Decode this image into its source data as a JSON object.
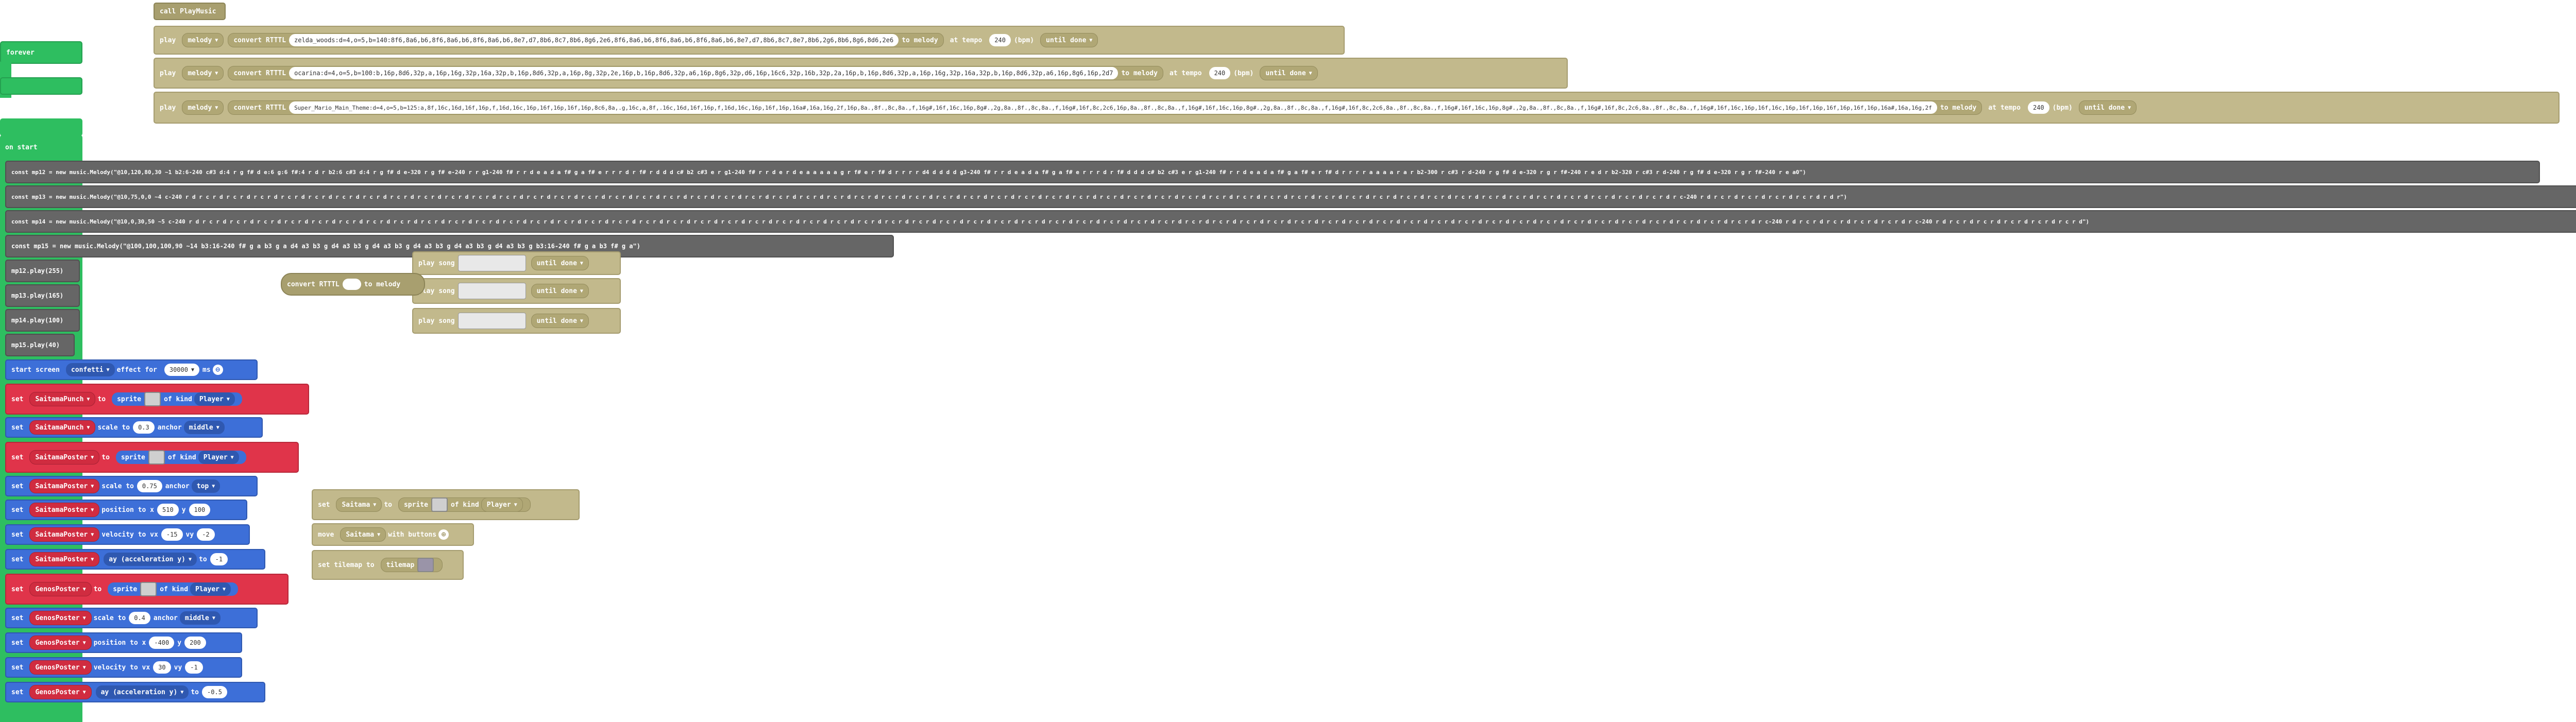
{
  "header": {
    "fn_label": "call PlayMusic"
  },
  "play_rows": [
    {
      "play": "play",
      "melody": "melody",
      "convert": "convert RTTTL",
      "rtttl": "zelda_woods:d=4,o=5,b=140:8f6,8a6,b6,8f6,8a6,b6,8f6,8a6,b6,8e7,d7,8b6,8c7,8b6,8g6,2e6,8f6,8a6,b6,8f6,8a6,b6,8f6,8a6,b6,8e7,d7,8b6,8c7,8e7,8b6,2g6,8b6,8g6,8d6,2e6",
      "to_melody": "to melody",
      "at_tempo": "at tempo",
      "tempo": "240",
      "bpm": "(bpm)",
      "until": "until done"
    },
    {
      "play": "play",
      "melody": "melody",
      "convert": "convert RTTTL",
      "rtttl": "ocarina:d=4,o=5,b=100:b,16p,8d6,32p,a,16p,16g,32p,16a,32p,b,16p,8d6,32p,a,16p,8g,32p,2e,16p,b,16p,8d6,32p,a6,16p,8g6,32p,d6,16p,16c6,32p,16b,32p,2a,16p,b,16p,8d6,32p,a,16p,16g,32p,16a,32p,b,16p,8d6,32p,a6,16p,8g6,16p,2d7",
      "to_melody": "to melody",
      "at_tempo": "at tempo",
      "tempo": "240",
      "bpm": "(bpm)",
      "until": "until done"
    },
    {
      "play": "play",
      "melody": "melody",
      "convert": "convert RTTTL",
      "rtttl": "Super_Mario_Main_Theme:d=4,o=5,b=125:a,8f,16c,16d,16f,16p,f,16d,16c,16p,16f,16p,16f,16p,8c6,8a,.g,16c,a,8f,.16c,16d,16f,16p,f,16d,16c,16p,16f,16p,16a#,16a,16g,2f,16p,8a.,8f.,8c,8a.,f,16g#,16f,16c,16p,8g#.,2g,8a.,8f.,8c,8a.,f,16g#,16f,8c,2c6,16p,8a.,8f.,8c,8a.,f,16g#,16f,16c,16p,8g#.,2g,8a.,8f.,8c,8a.,f,16g#,16f,8c,2c6,8a.,8f.,8c,8a.,f,16g#,16f,16c,16p,8g#.,2g,8a.,8f.,8c,8a.,f,16g#,16f,8c,2c6,8a.,8f.,8c,8a.,f,16g#,16f,16c,16p,16f,16c,16p,16f,16p,16f,16p,16f,16p,16a#,16a,16g,2f",
      "to_melody": "to melody",
      "at_tempo": "at tempo",
      "tempo": "240",
      "bpm": "(bpm)",
      "until": "until done"
    }
  ],
  "forever": {
    "label": "forever"
  },
  "on_start": {
    "label": "on start"
  },
  "const_rows": [
    {
      "text": "const mp12 = new music.Melody(\"@10,120,80,30 ~1 b2:6-240 c#3 d:4 r g f# d e:6 g:6 f#:4 r d r b2:6 c#3 d:4 r g f# d e-320 r g f# e-240 r r g1-240 f# r r d e a d a f# g a f# e r r r d r f# r d d d c# b2 c#3 e r g1-240 f# r r d e r d e a a a a a g r f# e r f# d r r r r d4 d d d d g3-240 f# r r d e a d a f# g a f# e r r r d r f# d d d c# b2 c#3 e r g1-240 f# r r d e a d a f# g a f# e r f# d r r r r a a a a r a r b2-300 r c#3 r d-240 r g f# d e-320 r g r f#-240 r e d r b2-320 r c#3 r d-240 r g f# d e-320 r g r f#-240 r e a0\")"
    },
    {
      "text": "const mp13 = new music.Melody(\"@10,75,0,0 ~4 c-240 r d r c r d r c r d r c r d r c r d r c r d r c r d r c r d r c r d r c r d r c r d r c r d r c r d r c r d r c r d r c r d r c r d r c r d r c r d r c r d r c r d r c r d r c r d r c r d r c r d r c r d r c r d r c r d r c r d r c r d r c r d r c r d r c r d r c r d r c r d r c r d r c r d r c r d r c r d r c r d r c r d r c r d r c r d r c r d r c r d r c r d r c r d r c r d r c r d r c r d r c r d r c r d r c r d r c r d r c r d r c-240 r d r c r d r c r d r c r d r c r d r d r\")"
    },
    {
      "text": "const mp14 = new music.Melody(\"@10,0,30,50 ~5 c-240 r d r c r d r c r d r c r d r c r d r c r d r c r d r c r d r c r d r c r d r c r d r c r d r c r d r c r d r c r d r c r d r c r d r c r d r c r d r c r d r c r d r c r d r c r d r c r d r c r d r c r d r c r d r c r d r c r d r c r d r c r d r c r d r c r d r c r d r c r d r c r d r c r d r c r d r c r d r c r d r c r d r c r d r c r d r c r d r c r d r c r d r c r d r c r d r c r d r c r d r c r d r c r d r c r d r c r d r c r d r c r d r c r d r c r d r c-240 r d r c r d r c r d r c r d r c r d r c-240 r d r c r d r c r d r c r d r c r d r c r d\")"
    },
    {
      "text": "const mp15 = new music.Melody(\"@100,100,100,90 ~14 b3:16-240 f# g a b3 g a d4 a3 b3 g d4 a3 b3 g d4 a3 b3 g d4 a3 b3 g d4 a3 b3 g d4 a3 b3 g b3:16-240 f# g a b3 f# g a\")"
    }
  ],
  "mp_plays": [
    "mp12.play(255)",
    "mp13.play(165)",
    "mp14.play(100)",
    "mp15.play(40)"
  ],
  "song_rows": [
    {
      "play": "play",
      "song": "song",
      "until": "until done"
    },
    {
      "play": "play",
      "song": "song",
      "until": "until done"
    },
    {
      "play": "play",
      "song": "song",
      "until": "until done"
    }
  ],
  "convert_small": {
    "label": "convert RTTTL",
    "to_melody": "to melody"
  },
  "effect": {
    "start": "start screen",
    "name": "confetti",
    "effect_for": "effect for",
    "ms_value": "30000",
    "ms": "ms"
  },
  "sprite_blocks": [
    {
      "set": "set",
      "var": "SaitamaPunch",
      "to": "to",
      "sprite": "sprite",
      "of_kind": "of kind",
      "kind": "Player"
    },
    {
      "set": "set",
      "var": "SaitamaPoster",
      "to": "to",
      "sprite": "sprite",
      "of_kind": "of kind",
      "kind": "Player"
    },
    {
      "set": "set",
      "var": "GenosPoster",
      "to": "to",
      "sprite": "sprite",
      "of_kind": "of kind",
      "kind": "Player"
    }
  ],
  "blue_rows": [
    {
      "set": "set",
      "var": "SaitamaPunch",
      "a": "scale to",
      "v1": "0.3",
      "b": "anchor",
      "c": "middle",
      "d": ""
    },
    {
      "set": "set",
      "var": "SaitamaPoster",
      "a": "scale to",
      "v1": "0.75",
      "b": "anchor",
      "c": "top",
      "d": ""
    },
    {
      "set": "set",
      "var": "SaitamaPoster",
      "a": "position to x",
      "v1": "510",
      "b": "y",
      "c": "100",
      "d": ""
    },
    {
      "set": "set",
      "var": "SaitamaPoster",
      "a": "velocity to vx",
      "v1": "-15",
      "b": "vy",
      "c": "-2",
      "d": ""
    },
    {
      "set": "set",
      "var": "SaitamaPoster",
      "a": "ay (acceleration y)",
      "v1": "",
      "b": "to",
      "c": "-1",
      "d": ""
    },
    {
      "set": "set",
      "var": "GenosPoster",
      "a": "scale to",
      "v1": "0.4",
      "b": "anchor",
      "c": "middle",
      "d": ""
    },
    {
      "set": "set",
      "var": "GenosPoster",
      "a": "position to x",
      "v1": "-400",
      "b": "y",
      "c": "200",
      "d": ""
    },
    {
      "set": "set",
      "var": "GenosPoster",
      "a": "velocity to vx",
      "v1": "30",
      "b": "vy",
      "c": "-1",
      "d": ""
    },
    {
      "set": "set",
      "var": "GenosPoster",
      "a": "ay (acceleration y)",
      "v1": "",
      "b": "to",
      "c": "-0.5",
      "d": ""
    }
  ],
  "saitama_group": {
    "set": "set",
    "var": "Saitama",
    "to": "to",
    "sprite": "sprite",
    "of_kind": "of kind",
    "kind": "Player",
    "move": "move",
    "move_var": "Saitama",
    "with_buttons": "with buttons",
    "tilemap_label": "set tilemap to",
    "tilemap": "tilemap"
  }
}
